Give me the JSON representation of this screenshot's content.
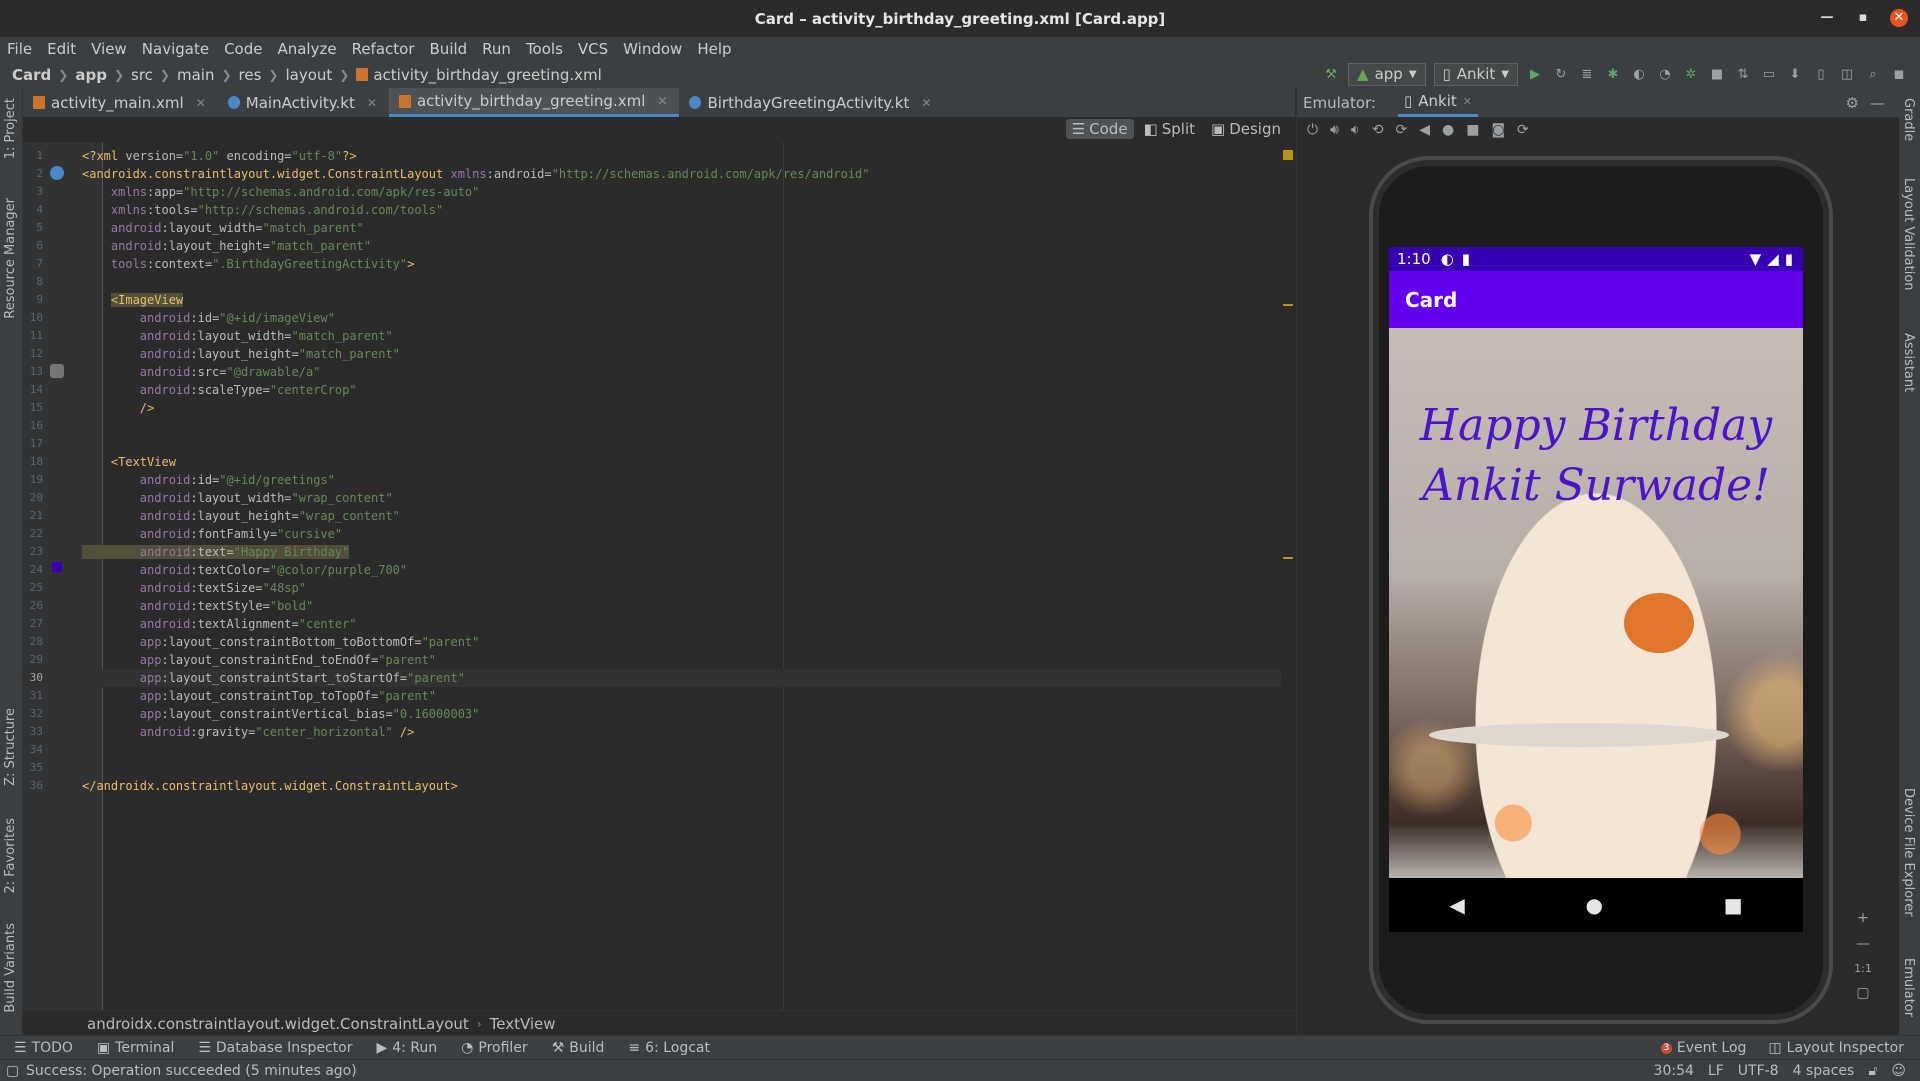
{
  "window": {
    "title": "Card – activity_birthday_greeting.xml [Card.app]"
  },
  "menu": [
    "File",
    "Edit",
    "View",
    "Navigate",
    "Code",
    "Analyze",
    "Refactor",
    "Build",
    "Run",
    "Tools",
    "VCS",
    "Window",
    "Help"
  ],
  "breadcrumbs": [
    "Card",
    "app",
    "src",
    "main",
    "res",
    "layout",
    "activity_birthday_greeting.xml"
  ],
  "run_config": {
    "module": "app",
    "device": "Ankit"
  },
  "tabs": [
    {
      "label": "activity_main.xml",
      "type": "xml"
    },
    {
      "label": "MainActivity.kt",
      "type": "kt"
    },
    {
      "label": "activity_birthday_greeting.xml",
      "type": "xml",
      "active": true
    },
    {
      "label": "BirthdayGreetingActivity.kt",
      "type": "kt"
    }
  ],
  "editor_modes": {
    "code": "Code",
    "split": "Split",
    "design": "Design"
  },
  "left_stripe": {
    "project": "1: Project",
    "resource_manager": "Resource Manager",
    "structure": "Z: Structure",
    "favorites": "2: Favorites",
    "build_variants": "Build Variants"
  },
  "right_stripe": {
    "gradle": "Gradle",
    "layout_validation": "Layout Validation",
    "assistant": "Assistant",
    "device_file_explorer": "Device File Explorer",
    "emulator": "Emulator"
  },
  "code_lines": [
    {
      "n": "1",
      "t": "<?xml version=\"1.0\" encoding=\"utf-8\"?>"
    },
    {
      "n": "2",
      "t": "<androidx.constraintlayout.widget.ConstraintLayout xmlns:android=\"http://schemas.android.com/apk/res/android\""
    },
    {
      "n": "3",
      "t": "    xmlns:app=\"http://schemas.android.com/apk/res-auto\""
    },
    {
      "n": "4",
      "t": "    xmlns:tools=\"http://schemas.android.com/tools\""
    },
    {
      "n": "5",
      "t": "    android:layout_width=\"match_parent\""
    },
    {
      "n": "6",
      "t": "    android:layout_height=\"match_parent\""
    },
    {
      "n": "7",
      "t": "    tools:context=\".BirthdayGreetingActivity\">"
    },
    {
      "n": "8",
      "t": ""
    },
    {
      "n": "9",
      "t": "    <ImageView"
    },
    {
      "n": "10",
      "t": "        android:id=\"@+id/imageView\""
    },
    {
      "n": "11",
      "t": "        android:layout_width=\"match_parent\""
    },
    {
      "n": "12",
      "t": "        android:layout_height=\"match_parent\""
    },
    {
      "n": "13",
      "t": "        android:src=\"@drawable/a\""
    },
    {
      "n": "14",
      "t": "        android:scaleType=\"centerCrop\""
    },
    {
      "n": "15",
      "t": "        />"
    },
    {
      "n": "16",
      "t": ""
    },
    {
      "n": "17",
      "t": ""
    },
    {
      "n": "18",
      "t": "    <TextView"
    },
    {
      "n": "19",
      "t": "        android:id=\"@+id/greetings\""
    },
    {
      "n": "20",
      "t": "        android:layout_width=\"wrap_content\""
    },
    {
      "n": "21",
      "t": "        android:layout_height=\"wrap_content\""
    },
    {
      "n": "22",
      "t": "        android:fontFamily=\"cursive\""
    },
    {
      "n": "23",
      "t": "        android:text=\"Happy Birthday\""
    },
    {
      "n": "24",
      "t": "        android:textColor=\"@color/purple_700\""
    },
    {
      "n": "25",
      "t": "        android:textSize=\"48sp\""
    },
    {
      "n": "26",
      "t": "        android:textStyle=\"bold\""
    },
    {
      "n": "27",
      "t": "        android:textAlignment=\"center\""
    },
    {
      "n": "28",
      "t": "        app:layout_constraintBottom_toBottomOf=\"parent\""
    },
    {
      "n": "29",
      "t": "        app:layout_constraintEnd_toEndOf=\"parent\""
    },
    {
      "n": "30",
      "t": "        app:layout_constraintStart_toStartOf=\"parent\""
    },
    {
      "n": "31",
      "t": "        app:layout_constraintTop_toTopOf=\"parent\""
    },
    {
      "n": "32",
      "t": "        app:layout_constraintVertical_bias=\"0.16000003\""
    },
    {
      "n": "33",
      "t": "        android:gravity=\"center_horizontal\" />"
    },
    {
      "n": "34",
      "t": ""
    },
    {
      "n": "35",
      "t": ""
    },
    {
      "n": "36",
      "t": "</androidx.constraintlayout.widget.ConstraintLayout>"
    }
  ],
  "current_line": "30",
  "editor_breadcrumb": [
    "androidx.constraintlayout.widget.ConstraintLayout",
    "TextView"
  ],
  "emulator": {
    "label": "Emulator:",
    "device_tab": "Ankit",
    "phone": {
      "time": "1:10",
      "app_title": "Card",
      "greeting_line1": "Happy Birthday",
      "greeting_line2": "Ankit Surwade!"
    },
    "zoom_ratio": "1:1"
  },
  "bottom_tools": [
    "TODO",
    "Terminal",
    "Database Inspector",
    "4: Run",
    "Profiler",
    "Build",
    "6: Logcat"
  ],
  "bottom_right": {
    "event_log": "Event Log",
    "event_count": "3",
    "layout_inspector": "Layout Inspector"
  },
  "status": {
    "message": "Success: Operation succeeded (5 minutes ago)",
    "position": "30:54",
    "line_sep": "LF",
    "encoding": "UTF-8",
    "indent": "4 spaces"
  },
  "colors": {
    "accent": "#4a88c7",
    "app_bar": "#6200ee",
    "status_bar": "#3700b3",
    "greeting": "#4a14c8"
  }
}
